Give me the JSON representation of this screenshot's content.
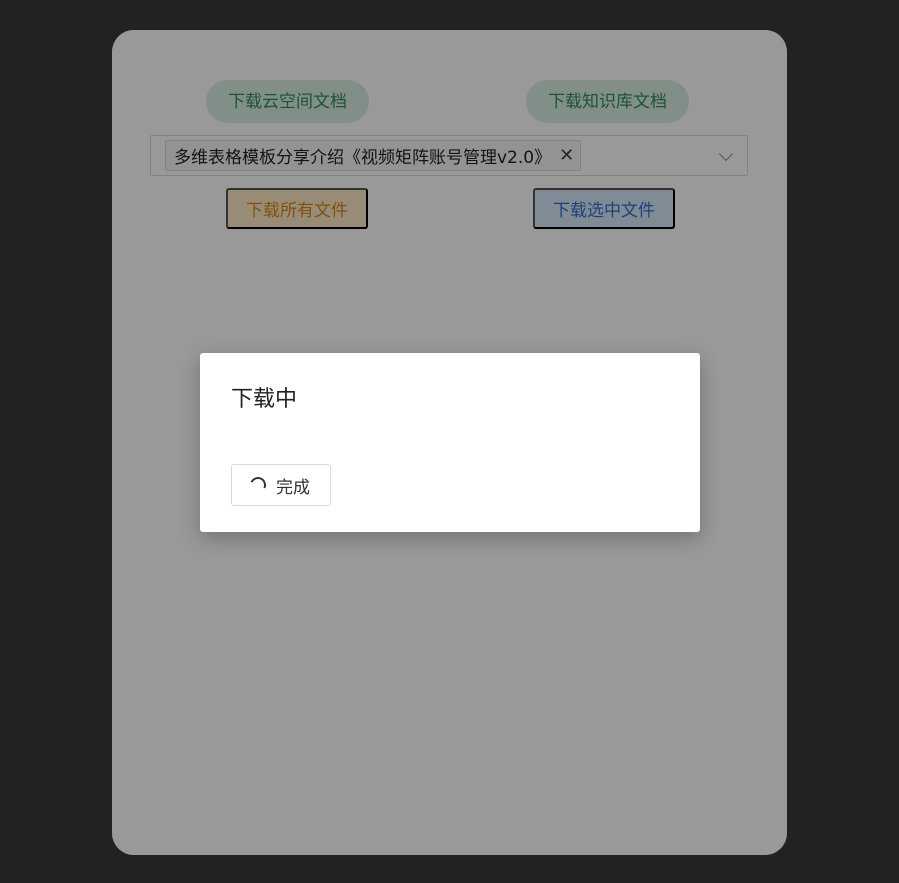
{
  "buttons": {
    "download_cloud": "下载云空间文档",
    "download_wiki": "下载知识库文档",
    "download_all": "下载所有文件",
    "download_selected": "下载选中文件"
  },
  "select": {
    "selected_tag": "多维表格模板分享介绍《视频矩阵账号管理v2.0》",
    "close_glyph": "✕"
  },
  "dialog": {
    "title": "下载中",
    "done_label": "完成"
  },
  "colors": {
    "green_text": "#2f8a56",
    "orange_text": "#d9861c",
    "blue_text": "#2f6fc8"
  }
}
